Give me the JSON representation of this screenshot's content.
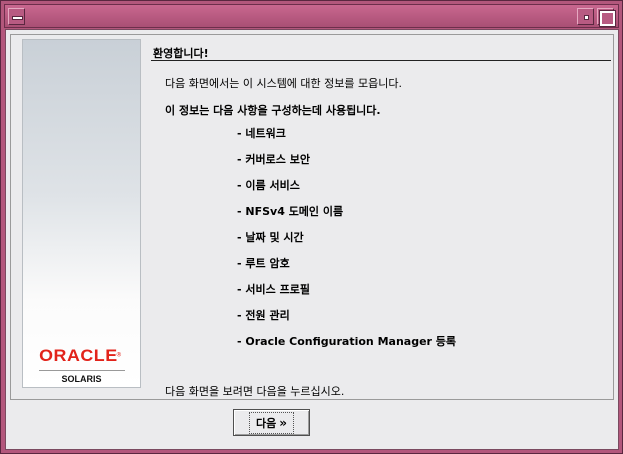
{
  "window": {
    "title": ""
  },
  "brand": {
    "logo_text": "ORACLE",
    "logo_mark": "®",
    "product": "SOLARIS"
  },
  "header": {
    "title": "환영합니다!"
  },
  "intro": {
    "line1": "다음 화면에서는 이 시스템에 대한 정보를 모읍니다.",
    "line2": "이 정보는 다음 사항을 구성하는데 사용됩니다."
  },
  "items": [
    "- 네트워크",
    "- 커버로스 보안",
    "- 이름 서비스",
    "- NFSv4 도메인 이름",
    "- 날짜 및 시간",
    "- 루트 암호",
    "- 서비스 프로필",
    "- 전원 관리",
    "- Oracle Configuration Manager 등록"
  ],
  "footer": {
    "hint": "다음 화면을 보려면 다음을 누르십시오."
  },
  "buttons": {
    "next_label": "다음",
    "next_icon": "»"
  },
  "icons": {
    "window_menu": "window-menu-icon",
    "minimize": "minimize-icon",
    "maximize": "maximize-icon",
    "next": "double-chevron-right-icon"
  },
  "colors": {
    "titlebar": "#b3577c",
    "oracle_red": "#e2231a",
    "background": "#ebebed"
  }
}
